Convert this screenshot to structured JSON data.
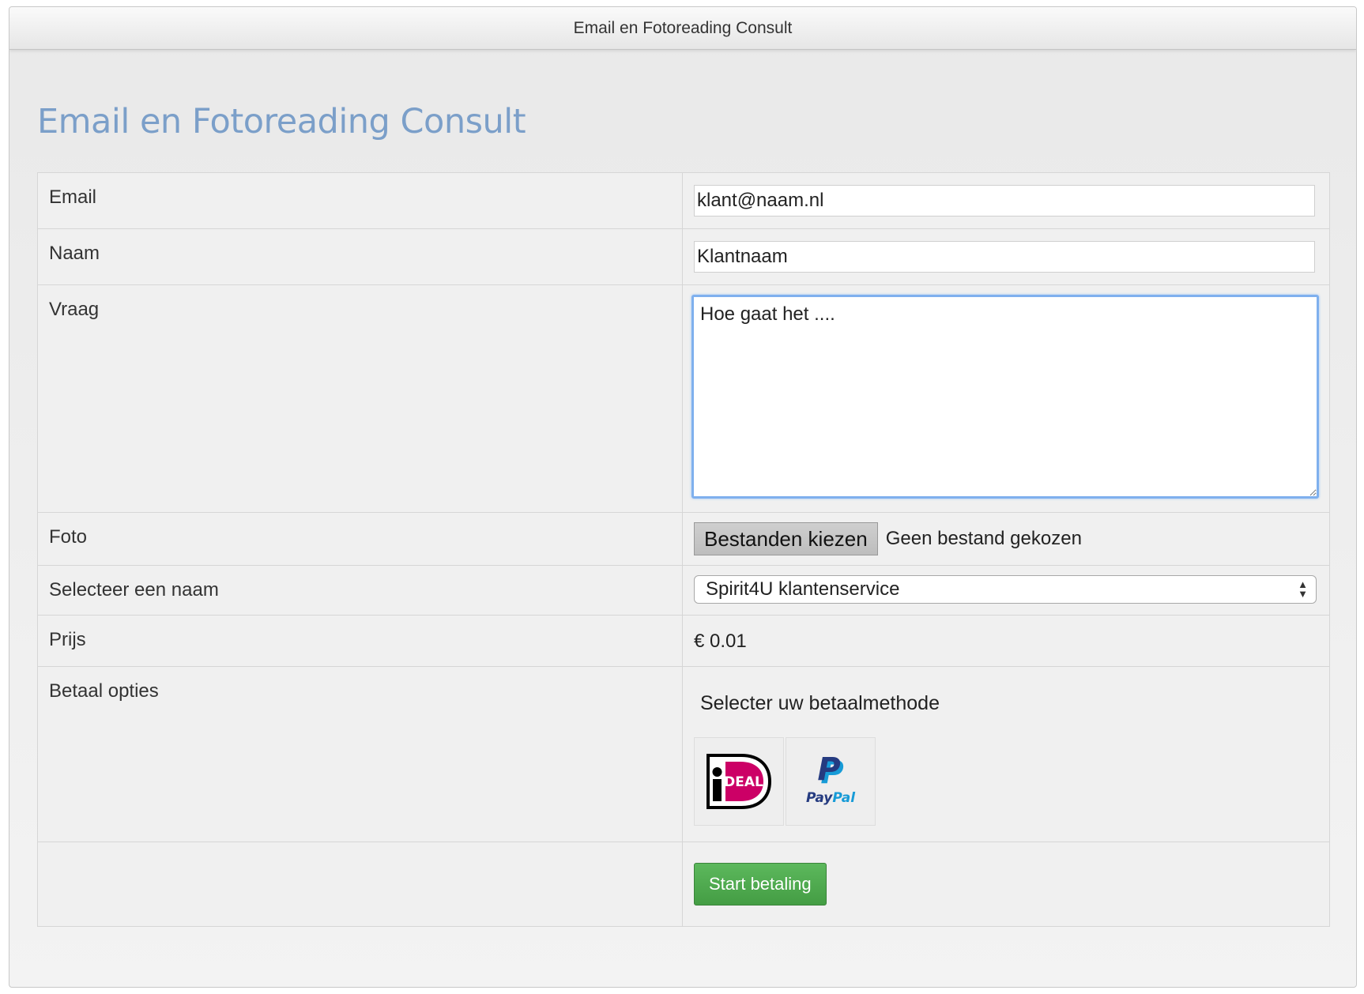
{
  "window": {
    "title": "Email en Fotoreading Consult"
  },
  "page": {
    "heading": "Email en Fotoreading Consult"
  },
  "form": {
    "email": {
      "label": "Email",
      "value": "klant@naam.nl"
    },
    "naam": {
      "label": "Naam",
      "value": "Klantnaam"
    },
    "vraag": {
      "label": "Vraag",
      "value": "Hoe gaat het ...."
    },
    "foto": {
      "label": "Foto",
      "button_label": "Bestanden kiezen",
      "status": "Geen bestand gekozen"
    },
    "selecteer": {
      "label": "Selecteer een naam",
      "selected": "Spirit4U klantenservice"
    },
    "prijs": {
      "label": "Prijs",
      "value": "€ 0.01"
    },
    "betaal": {
      "label": "Betaal opties",
      "title": "Selecter uw betaalmethode",
      "options": [
        {
          "name": "iDEAL",
          "logo_text": "iDEAL",
          "color": "#cc0066"
        },
        {
          "name": "PayPal",
          "logo_text": "PayPal",
          "color": "#253b80"
        }
      ]
    },
    "submit_label": "Start betaling"
  },
  "colors": {
    "heading": "#7b9fc9",
    "submit": "#5cb85c",
    "focus": "#7fb0ee"
  }
}
